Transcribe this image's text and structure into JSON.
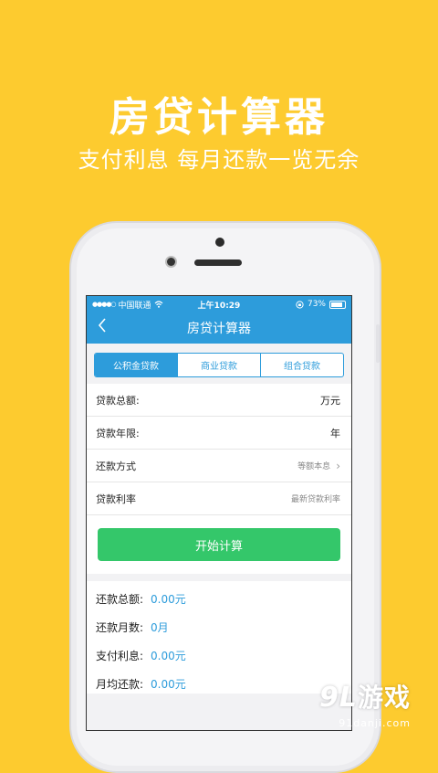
{
  "promo": {
    "title": "房贷计算器",
    "subtitle": "支付利息  每月还款一览无余"
  },
  "status": {
    "signal": "●●●●○",
    "carrier": "中国联通",
    "wifi_icon": "wifi-icon",
    "time": "上午10:29",
    "battery_pct": "73%",
    "battery_level": 0.73
  },
  "nav": {
    "back_icon": "chevron-left-icon",
    "title": "房贷计算器"
  },
  "tabs": [
    {
      "label": "公积金贷款",
      "active": true
    },
    {
      "label": "商业贷款",
      "active": false
    },
    {
      "label": "组合贷款",
      "active": false
    }
  ],
  "form": {
    "total": {
      "label": "贷款总额:",
      "unit": "万元"
    },
    "term": {
      "label": "贷款年限:",
      "unit": "年"
    },
    "method": {
      "label": "还款方式",
      "value": "等额本息"
    },
    "rate": {
      "label": "贷款利率",
      "value": "最新贷款利率"
    }
  },
  "calc_button": "开始计算",
  "results": [
    {
      "label": "还款总额:",
      "value": "0.00元"
    },
    {
      "label": "还款月数:",
      "value": "0月"
    },
    {
      "label": "支付利息:",
      "value": "0.00元"
    },
    {
      "label": "月均还款:",
      "value": "0.00元"
    }
  ],
  "watermark": {
    "logo": "9L",
    "text": "游戏",
    "domain": "91danji.com"
  },
  "colors": {
    "background": "#FDCB2F",
    "accent": "#2D9CDB",
    "button": "#34C76A"
  }
}
